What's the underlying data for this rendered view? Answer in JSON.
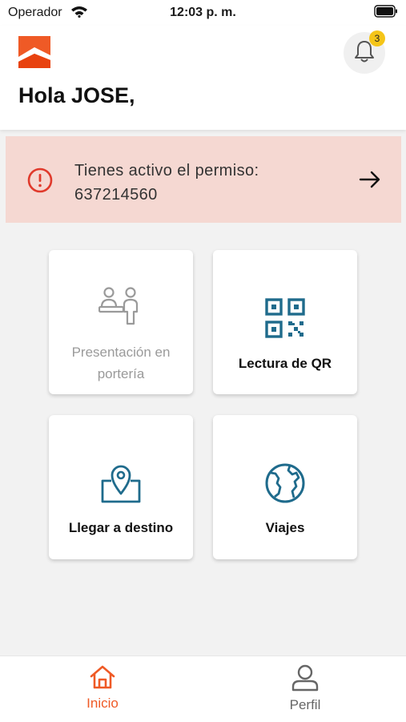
{
  "status_bar": {
    "carrier": "Operador",
    "time": "12:03 p. m."
  },
  "header": {
    "greeting": "Hola JOSE,",
    "notification_count": "3"
  },
  "alert": {
    "text": "Tienes activo el permiso: 637214560"
  },
  "tiles": [
    {
      "label": "Presentación en portería",
      "icon": "gate-presentation-icon",
      "enabled": false
    },
    {
      "label": "Lectura de QR",
      "icon": "qr-code-icon",
      "enabled": true
    },
    {
      "label": "Llegar a destino",
      "icon": "map-pin-icon",
      "enabled": true
    },
    {
      "label": "Viajes",
      "icon": "globe-icon",
      "enabled": true
    }
  ],
  "bottom_nav": [
    {
      "label": "Inicio",
      "icon": "home-icon",
      "active": true
    },
    {
      "label": "Perfil",
      "icon": "profile-icon",
      "active": false
    }
  ],
  "colors": {
    "brand": "#ef5a26",
    "accent": "#1f6b8c",
    "alert_bg": "#f5d8d2",
    "alert_icon": "#e03a2c",
    "badge": "#f5c518"
  }
}
